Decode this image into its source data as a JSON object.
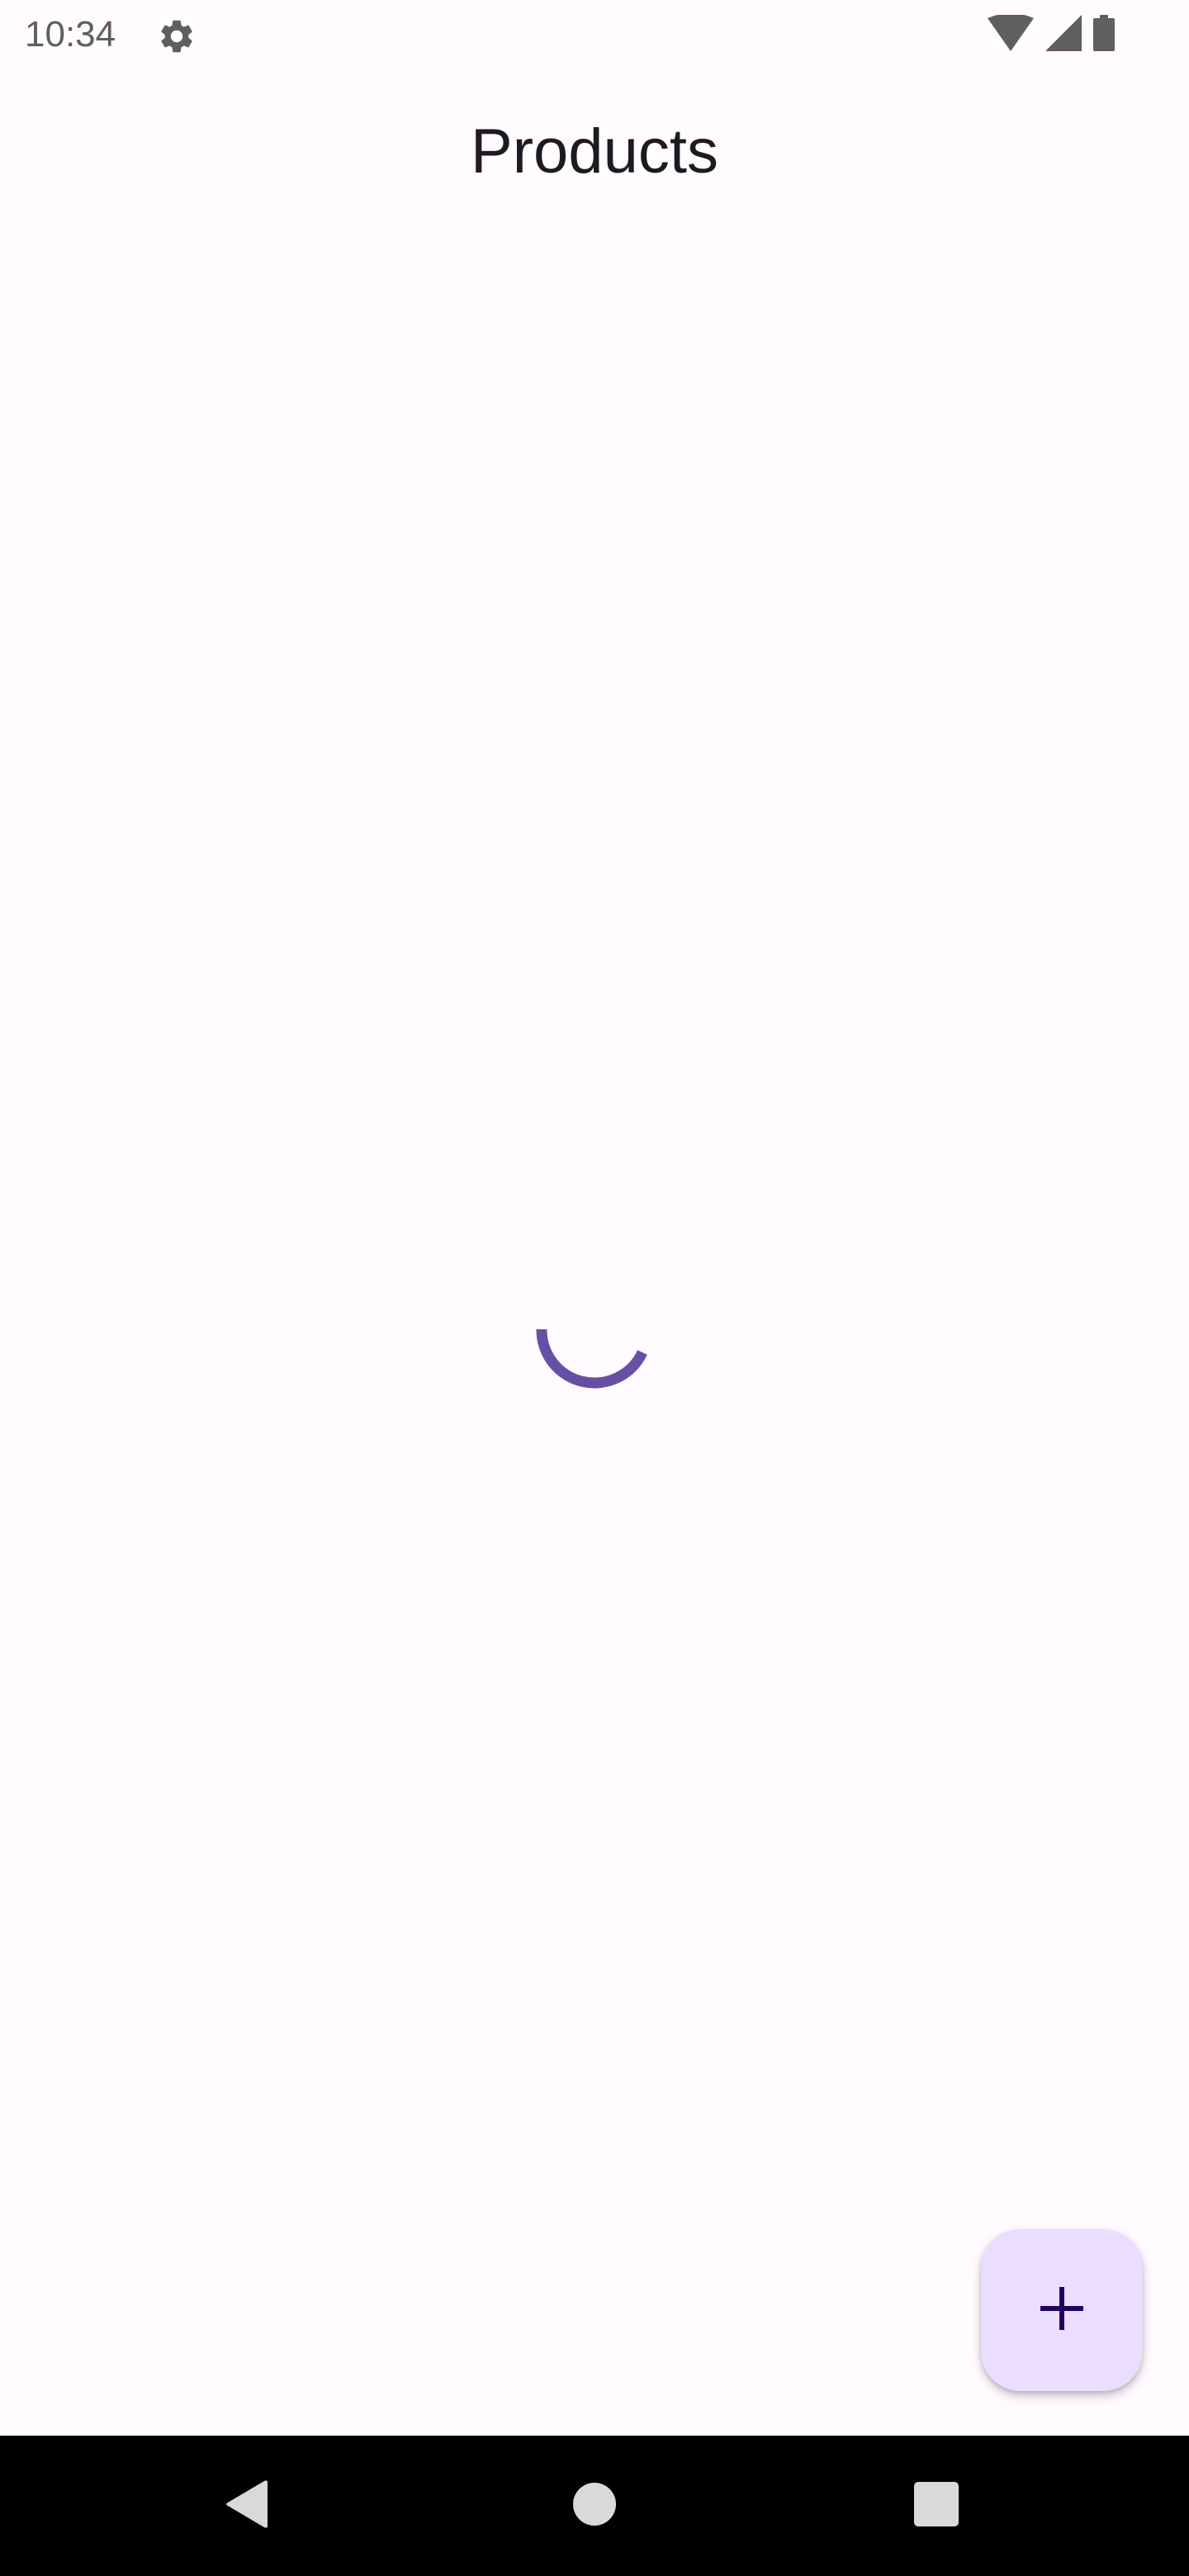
{
  "status_bar": {
    "time": "10:34",
    "icons": [
      "gear-icon",
      "wifi-icon",
      "cellular-signal-icon",
      "battery-icon"
    ]
  },
  "app_bar": {
    "title": "Products"
  },
  "content": {
    "loading": true,
    "spinner_color": "#6750A4"
  },
  "fab": {
    "icon": "plus-icon",
    "background": "#EADDFF",
    "icon_color": "#21005D"
  },
  "nav_bar": {
    "buttons": [
      "back-icon",
      "home-icon",
      "recents-icon"
    ]
  }
}
